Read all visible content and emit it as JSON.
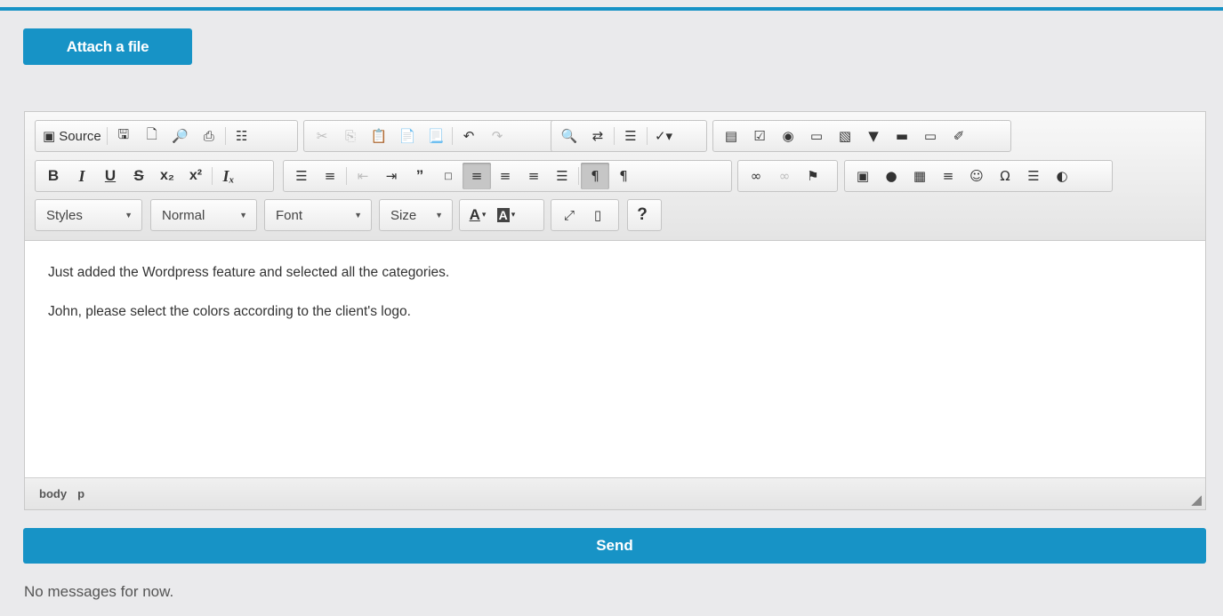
{
  "attach_button": {
    "label": "Attach a file"
  },
  "editor": {
    "toolbar": {
      "source_label": "Source",
      "combos": {
        "styles": "Styles",
        "format": "Normal",
        "font": "Font",
        "size": "Size"
      },
      "text_color_glyph": "A",
      "bg_color_glyph": "A",
      "help_glyph": "?"
    },
    "content": {
      "paragraphs": [
        "Just added the Wordpress feature and selected all the categories.",
        "John, please select the colors according to the client's logo."
      ]
    },
    "statusbar": {
      "path": [
        "body",
        "p"
      ]
    }
  },
  "send_button": {
    "label": "Send"
  },
  "messages": {
    "empty_text": "No messages for now."
  },
  "colors": {
    "accent": "#1793c6",
    "page_bg": "#eaeaec"
  }
}
